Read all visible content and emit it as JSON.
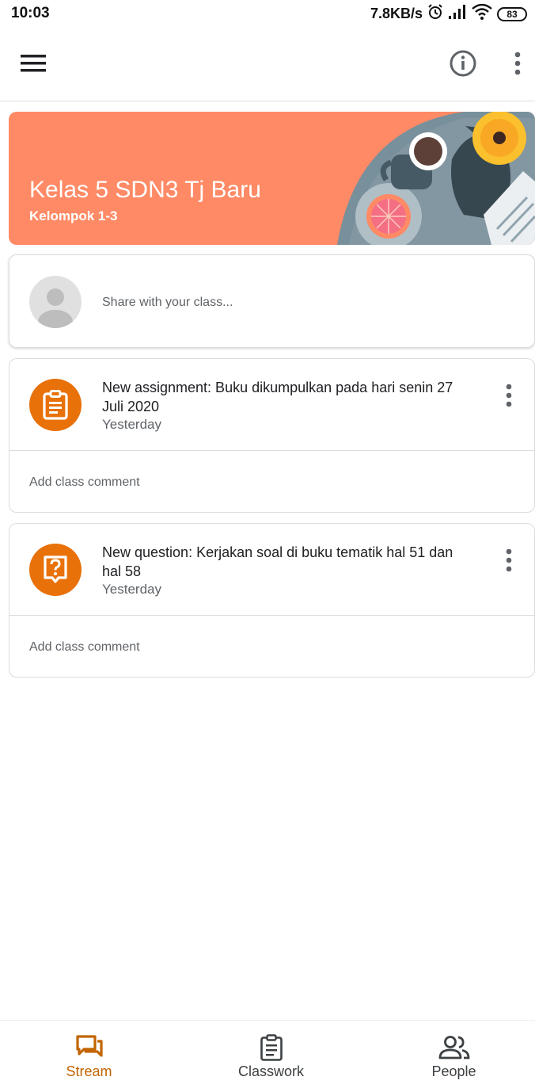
{
  "status_bar": {
    "time": "10:03",
    "network_speed": "7.8KB/s",
    "battery": "83",
    "icons": [
      "alarm-icon",
      "signal-icon",
      "wifi-icon",
      "battery-icon"
    ]
  },
  "app_bar": {
    "icons": [
      "menu-icon",
      "info-icon",
      "more-vert-icon"
    ]
  },
  "banner": {
    "title": "Kelas 5 SDN3 Tj Baru",
    "subtitle": "Kelompok 1-3",
    "color": "#ff8a65"
  },
  "share": {
    "placeholder": "Share with your class..."
  },
  "posts": [
    {
      "icon": "assignment-icon",
      "title": "New assignment: Buku dikumpulkan pada hari senin 27 Juli 2020",
      "date": "Yesterday",
      "comment_placeholder": "Add class comment"
    },
    {
      "icon": "question-icon",
      "title": "New question: Kerjakan soal di buku tematik hal 51 dan hal 58",
      "date": "Yesterday",
      "comment_placeholder": "Add class comment"
    }
  ],
  "bottom_nav": {
    "items": [
      {
        "label": "Stream",
        "icon": "stream-icon",
        "active": true
      },
      {
        "label": "Classwork",
        "icon": "classwork-icon",
        "active": false
      },
      {
        "label": "People",
        "icon": "people-icon",
        "active": false
      }
    ]
  },
  "colors": {
    "accent": "#e8710a",
    "active_nav": "#c26401",
    "banner": "#ff8a65"
  }
}
